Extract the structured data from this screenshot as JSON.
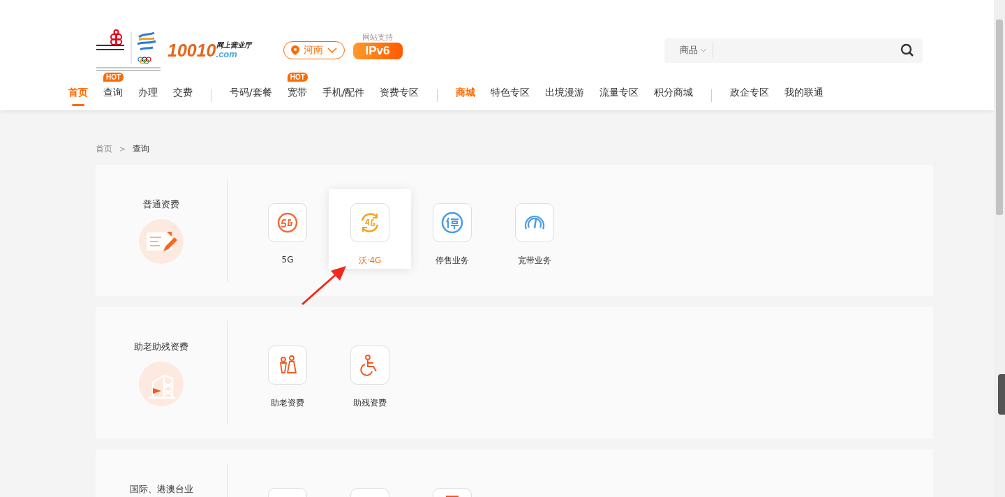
{
  "header": {
    "brand": {
      "number": "10010",
      "tagline": "网上营业厅",
      "domain": ".com"
    },
    "location": "河南",
    "ipv6": {
      "caption": "网站支持",
      "label": "IPv6"
    },
    "search": {
      "category": "商品"
    }
  },
  "nav": [
    [
      {
        "label": "首页",
        "selected": true
      },
      {
        "label": "查询",
        "selected": false,
        "badge": "HOT"
      },
      {
        "label": "办理",
        "selected": false
      },
      {
        "label": "交费",
        "selected": false
      }
    ],
    [
      {
        "label": "号码/套餐",
        "selected": false
      },
      {
        "label": "宽带",
        "selected": false,
        "badge": "HOT"
      },
      {
        "label": "手机/配件",
        "selected": false
      },
      {
        "label": "资费专区",
        "selected": false
      }
    ],
    [
      {
        "label": "商城",
        "selected": false,
        "accent": true
      },
      {
        "label": "特色专区",
        "selected": false,
        "accent": false
      },
      {
        "label": "出境漫游",
        "selected": false,
        "accent": false
      },
      {
        "label": "流量专区",
        "selected": false,
        "accent": false
      },
      {
        "label": "积分商城",
        "selected": false,
        "accent": false
      }
    ],
    [
      {
        "label": "政企专区",
        "selected": false
      },
      {
        "label": "我的联通",
        "selected": false
      }
    ]
  ],
  "breadcrumb": {
    "items": [
      "首页",
      "查询"
    ],
    "separator": ">"
  },
  "sections": [
    {
      "title": "普通资费",
      "kind": "note",
      "items": [
        {
          "label": "5G",
          "kind": "fiveg",
          "selected": false
        },
        {
          "label": "沃·4G",
          "kind": "fourg",
          "selected": true
        },
        {
          "label": "停售业务",
          "kind": "stop",
          "selected": false
        },
        {
          "label": "宽带业务",
          "kind": "gauge",
          "selected": false
        }
      ]
    },
    {
      "title": "助老助残资费",
      "kind": "building",
      "items": [
        {
          "label": "助老资费",
          "kind": "elder",
          "selected": false
        },
        {
          "label": "助残资费",
          "kind": "wheelchair",
          "selected": false
        }
      ]
    },
    {
      "title": "国际、港澳台业",
      "kind": "none",
      "items": [
        {
          "kind": "blank"
        },
        {
          "kind": "blank"
        },
        {
          "kind": "doc"
        }
      ]
    }
  ]
}
